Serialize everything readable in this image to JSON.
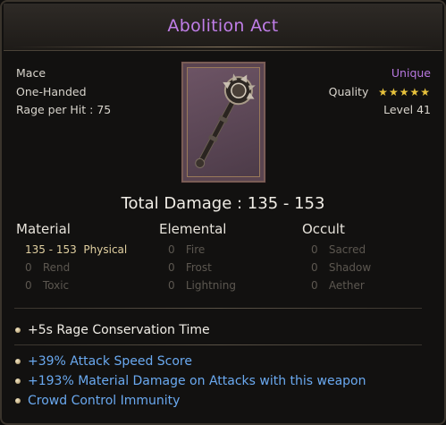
{
  "item": {
    "name": "Abolition Act",
    "type": "Mace",
    "handedness": "One-Handed",
    "rage_label": "Rage per Hit : 75",
    "rarity": "Unique",
    "quality_label": "Quality",
    "quality_stars": 5,
    "level_label": "Level 41"
  },
  "damage": {
    "total_label": "Total Damage : 135 - 153",
    "material": {
      "header": "Material",
      "rows": [
        {
          "value": "135 - 153",
          "label": "Physical"
        },
        {
          "value": "0",
          "label": "Rend"
        },
        {
          "value": "0",
          "label": "Toxic"
        }
      ]
    },
    "elemental": {
      "header": "Elemental",
      "rows": [
        {
          "value": "0",
          "label": "Fire"
        },
        {
          "value": "0",
          "label": "Frost"
        },
        {
          "value": "0",
          "label": "Lightning"
        }
      ]
    },
    "occult": {
      "header": "Occult",
      "rows": [
        {
          "value": "0",
          "label": "Sacred"
        },
        {
          "value": "0",
          "label": "Shadow"
        },
        {
          "value": "0",
          "label": "Aether"
        }
      ]
    }
  },
  "modifiers": {
    "innate": [
      "+5s Rage Conservation Time"
    ],
    "affixes": [
      "+39% Attack Speed Score",
      "+193% Material Damage on Attacks with this weapon",
      "Crowd Control Immunity"
    ]
  },
  "icons": {
    "bullet": "gem-bullet-icon",
    "weapon": "mace-icon",
    "star": "star-icon"
  },
  "colors": {
    "unique": "#c07ee8",
    "affix": "#6aa9f0",
    "star": "#e7c23c"
  }
}
